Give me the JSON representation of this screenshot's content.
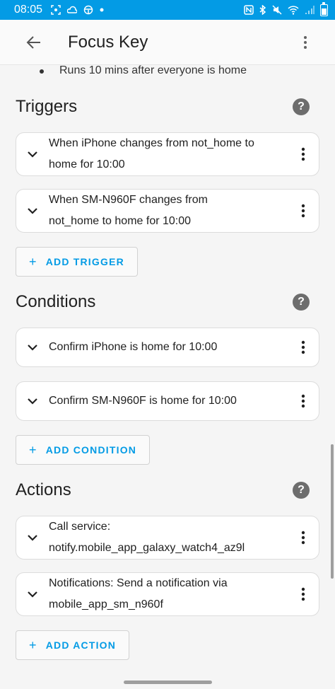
{
  "status_bar": {
    "time": "08:05",
    "icons": [
      "screenshot-icon",
      "cloud-icon",
      "steering-icon",
      "dot-icon"
    ],
    "right_icons": [
      "nfc-icon",
      "bluetooth-icon",
      "mute-icon",
      "wifi-icon",
      "signal-icon",
      "battery-icon"
    ]
  },
  "app_bar": {
    "title": "Focus Key"
  },
  "description": {
    "line": "Runs 10 mins after everyone is home"
  },
  "triggers": {
    "title": "Triggers",
    "items": [
      {
        "line1": "When iPhone changes from not_home to",
        "line2": "home for 10:00"
      },
      {
        "line1": "When SM-N960F changes from",
        "line2": "not_home to home for 10:00"
      }
    ],
    "add_label": "ADD TRIGGER"
  },
  "conditions": {
    "title": "Conditions",
    "items": [
      {
        "label": "Confirm iPhone is home for 10:00"
      },
      {
        "label": "Confirm SM-N960F is home for 10:00"
      }
    ],
    "add_label": "ADD CONDITION"
  },
  "actions": {
    "title": "Actions",
    "items": [
      {
        "line1": "Call service:",
        "line2": "notify.mobile_app_galaxy_watch4_az9l"
      },
      {
        "line1": "Notifications: Send a notification via",
        "line2": "mobile_app_sm_n960f"
      }
    ],
    "add_label": "ADD ACTION"
  },
  "colors": {
    "accent": "#039be5",
    "help_icon": "#6d6d6d"
  }
}
